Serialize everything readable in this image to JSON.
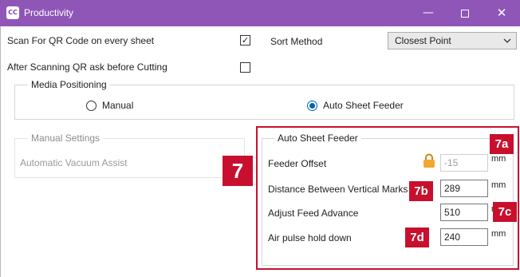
{
  "window": {
    "logo_text": "CC",
    "title": "Productivity",
    "minimize_icon": "—",
    "close_icon": "✕"
  },
  "options": {
    "scan_qr_label": "Scan For QR Code on every sheet",
    "scan_qr_checked": true,
    "scan_qr_mark": "✓",
    "ask_before_cutting_label": "After Scanning QR ask before Cutting",
    "ask_before_cutting_checked": false,
    "sort_method_label": "Sort Method",
    "sort_method_value": "Closest Point",
    "dropdown_icon": "chevron-down"
  },
  "media_positioning": {
    "legend": "Media Positioning",
    "manual_label": "Manual",
    "auto_label": "Auto Sheet Feeder",
    "selected": "Auto Sheet Feeder"
  },
  "manual_settings": {
    "legend": "Manual Settings",
    "vacuum_label": "Automatic Vacuum Assist"
  },
  "auto_sheet_feeder": {
    "legend": "Auto Sheet Feeder",
    "feeder_offset_label": "Feeder Offset",
    "feeder_offset_value": "-15",
    "feeder_offset_unit": "mm",
    "feeder_offset_locked": true,
    "vertical_marks_label": "Distance Between Vertical Marks",
    "vertical_marks_value": "289",
    "vertical_marks_unit": "mm",
    "feed_advance_label": "Adjust Feed Advance",
    "feed_advance_value": "510",
    "feed_advance_unit": "m",
    "air_pulse_label": "Air pulse hold down",
    "air_pulse_value": "240",
    "air_pulse_unit": "mm"
  },
  "callouts": {
    "main": "7",
    "a": "7a",
    "b": "7b",
    "c": "7c",
    "d": "7d",
    "color": "#c8102e"
  },
  "colors": {
    "titlebar": "#8f56b8",
    "radio_selected": "#0063b1",
    "lock": "#f0a830"
  }
}
